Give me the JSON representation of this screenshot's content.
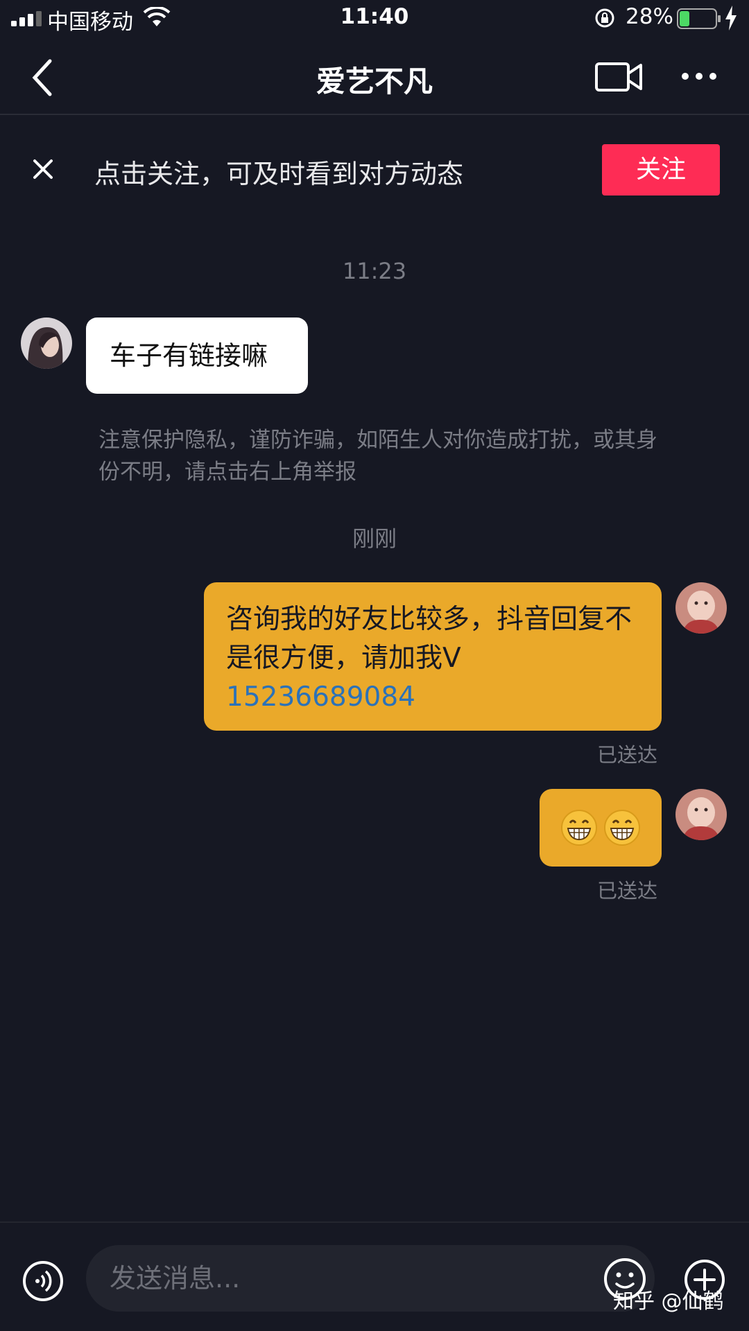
{
  "status_bar": {
    "carrier": "中国移动",
    "time": "11:40",
    "battery_percent": "28%",
    "battery_level": 0.28,
    "battery_color": "#4cd964"
  },
  "nav": {
    "title": "爱艺不凡",
    "back_icon": "chevron-left-icon",
    "video_icon": "video-camera-icon",
    "more_icon": "more-dots-icon"
  },
  "follow_banner": {
    "text": "点击关注，可及时看到对方动态",
    "button_label": "关注",
    "button_color": "#fe2c55"
  },
  "messages": {
    "timestamp_1": "11:23",
    "incoming_1": "车子有链接嘛",
    "privacy_notice": "注意保护隐私，谨防诈骗，如陌生人对你造成打扰，或其身份不明，请点击右上角举报",
    "timestamp_2": "刚刚",
    "outgoing_1_text": "咨询我的好友比较多，抖音回复不是很方便，请加我V",
    "outgoing_1_phone": "15236689084",
    "outgoing_1_status": "已送达",
    "outgoing_2_emoji": "😁😁",
    "outgoing_2_status": "已送达",
    "outgoing_bubble_color": "#eaa92a"
  },
  "input_bar": {
    "placeholder": "发送消息...",
    "voice_icon": "voice-icon",
    "emoji_icon": "emoji-face-icon",
    "plus_icon": "plus-circle-icon"
  },
  "watermark": "知乎 @仙鹤"
}
